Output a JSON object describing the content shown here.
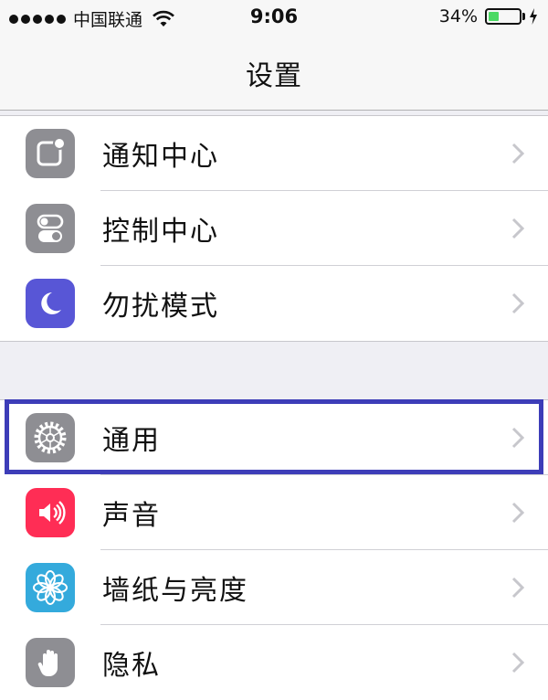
{
  "status_bar": {
    "carrier": "中国联通",
    "time": "9:06",
    "battery_percent_label": "34%",
    "battery_level": 0.34,
    "battery_color": "#4cd964"
  },
  "nav": {
    "title": "设置"
  },
  "groups": [
    {
      "items": [
        {
          "label": "通知中心",
          "icon": "notification-center-icon",
          "icon_color": "#8e8e93"
        },
        {
          "label": "控制中心",
          "icon": "control-center-icon",
          "icon_color": "#8e8e93"
        },
        {
          "label": "勿扰模式",
          "icon": "moon-icon",
          "icon_color": "#5856d6"
        }
      ]
    },
    {
      "items": [
        {
          "label": "通用",
          "icon": "gear-icon",
          "icon_color": "#8e8e93",
          "highlighted": true,
          "highlight_color": "#3d3db8"
        },
        {
          "label": "声音",
          "icon": "speaker-icon",
          "icon_color": "#ff2d55"
        },
        {
          "label": "墙纸与亮度",
          "icon": "flower-icon",
          "icon_color": "#34aadc"
        },
        {
          "label": "隐私",
          "icon": "hand-icon",
          "icon_color": "#8e8e93"
        }
      ]
    }
  ]
}
